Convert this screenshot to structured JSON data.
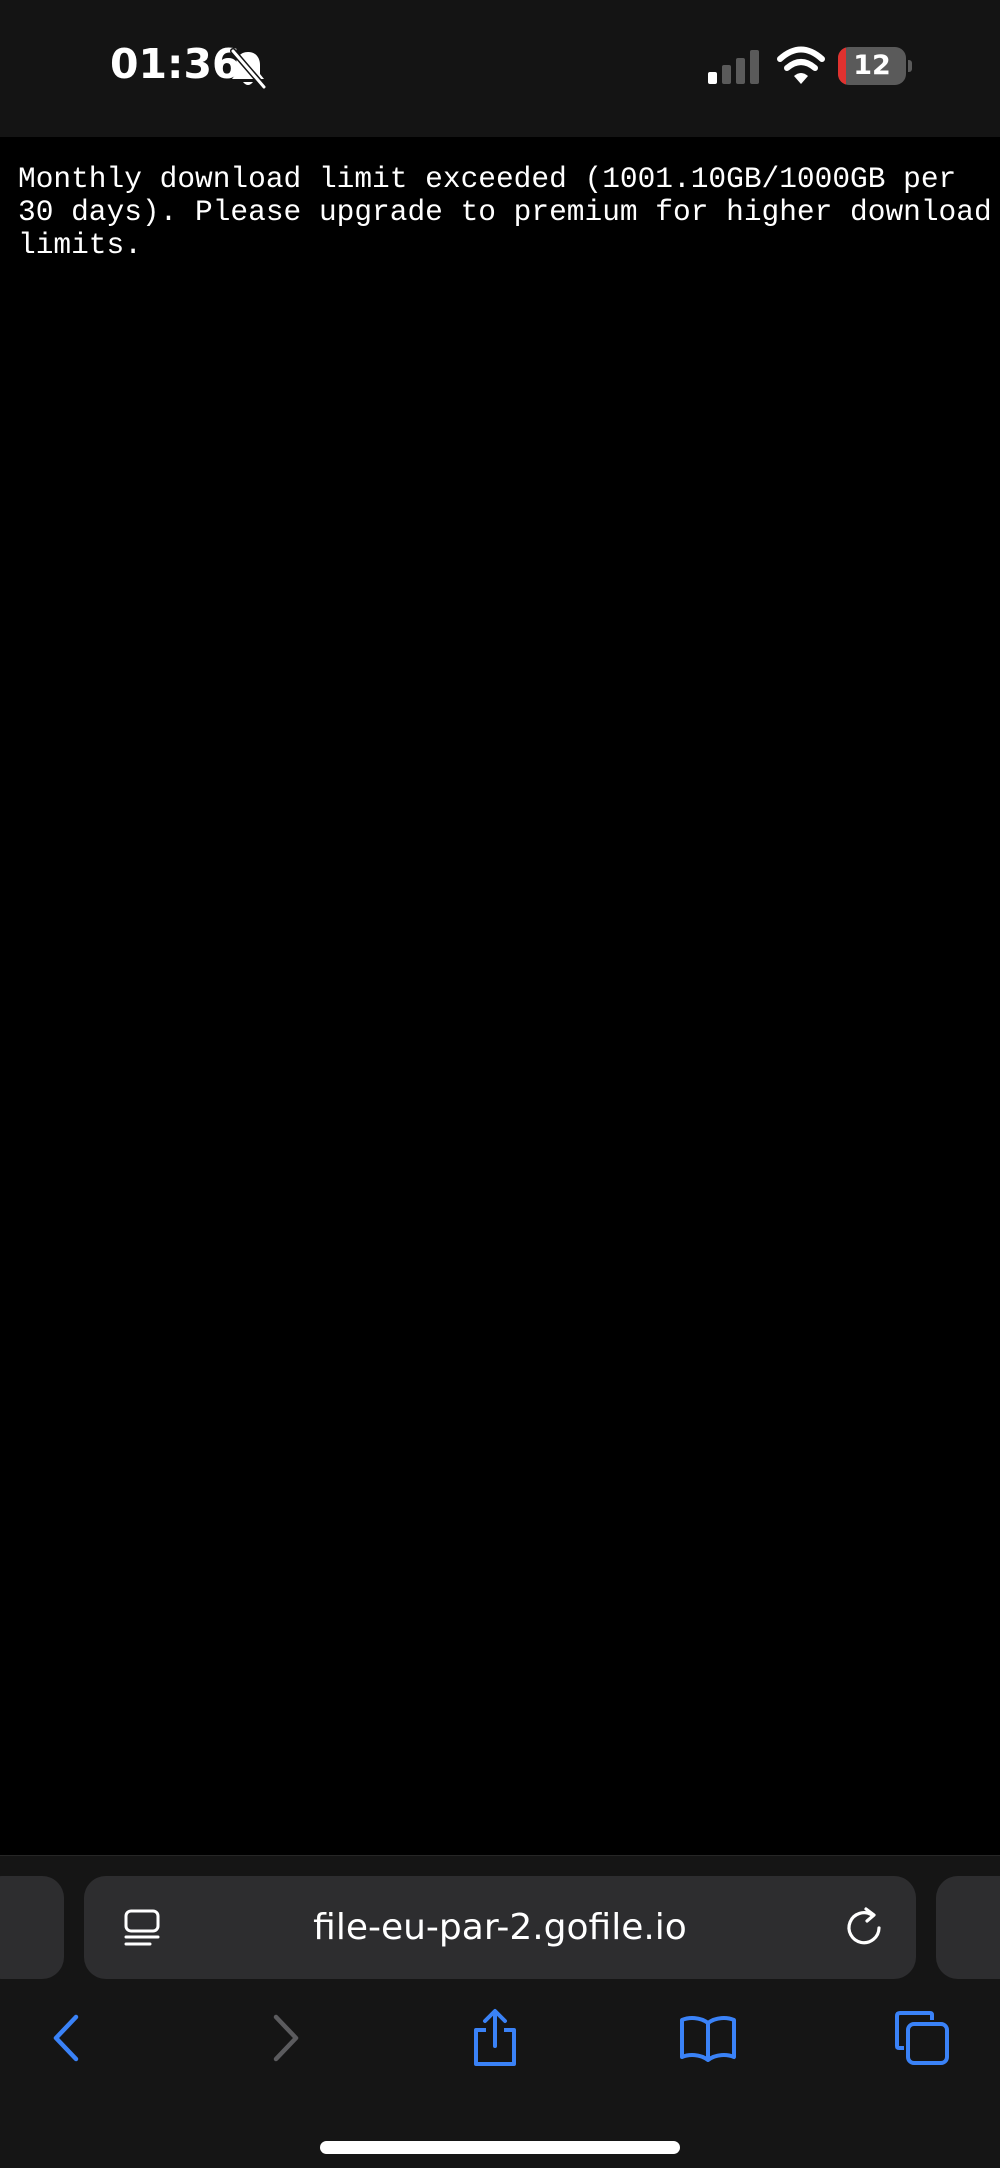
{
  "status_bar": {
    "time": "01:36",
    "battery_level": "12",
    "battery_fraction": 0.12,
    "signal_bars_active": 1,
    "icons": {
      "silent": "bell-slash-icon",
      "signal": "cellular-signal-icon",
      "wifi": "wifi-icon",
      "battery": "battery-icon"
    }
  },
  "page": {
    "message": "Monthly download limit exceeded (1001.10GB/1000GB per 30 days). Please upgrade to premium for higher download limits."
  },
  "browser": {
    "url": "file-eu-par-2.gofile.io",
    "icons": {
      "page_menu": "page-menu-icon",
      "reload": "reload-icon",
      "back": "chevron-left-icon",
      "forward": "chevron-right-icon",
      "share": "share-icon",
      "bookmarks": "book-icon",
      "tabs": "tabs-icon"
    }
  },
  "colors": {
    "accent": "#3a82f7",
    "disabled": "#5b5b5e",
    "battery_low": "#e0322f",
    "status_bar_bg": "#141414",
    "toolbar_bg": "#151515",
    "field_bg": "#2d2d2f"
  }
}
